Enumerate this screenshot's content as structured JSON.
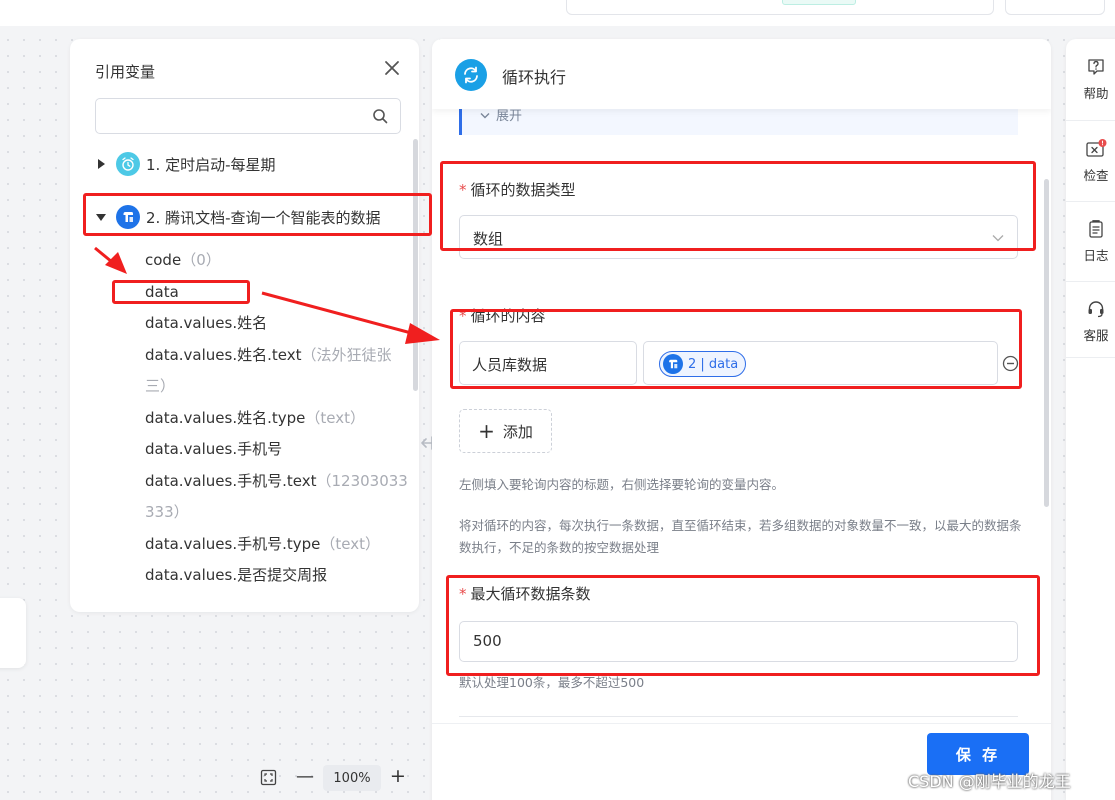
{
  "var_panel": {
    "title": "引用变量",
    "search_placeholder": "",
    "nodes": [
      {
        "label": "1. 定时启动-每星期",
        "color": "#4dc9e6"
      },
      {
        "label": "2. 腾讯文档-查询一个智能表的数据",
        "color": "#1e73e8"
      }
    ],
    "leaves": [
      {
        "name": "code",
        "hint": "（0）"
      },
      {
        "name": "data",
        "hint": ""
      },
      {
        "name": "data.values.姓名",
        "hint": ""
      },
      {
        "name": "data.values.姓名.text",
        "hint": "（法外狂徒张",
        "hint2": "三）"
      },
      {
        "name": "data.values.姓名.type",
        "hint": "（text）"
      },
      {
        "name": "data.values.手机号",
        "hint": ""
      },
      {
        "name": "data.values.手机号.text",
        "hint": "（12303033",
        "hint2": "333）"
      },
      {
        "name": "data.values.手机号.type",
        "hint": "（text）"
      },
      {
        "name": "data.values.是否提交周报",
        "hint": ""
      }
    ]
  },
  "main_panel": {
    "title": "循环执行",
    "expand_label": "展开",
    "data_type": {
      "label": "循环的数据类型",
      "value": "数组"
    },
    "content": {
      "label": "循环的内容",
      "title_value": "人员库数据",
      "tag_value": "2 | data",
      "add_label": "添加"
    },
    "help1": "左侧填入要轮询内容的标题，右侧选择要轮询的变量内容。",
    "help2": "将对循环的内容，每次执行一条数据，直至循环结束，若多组数据的对象数量不一致，以最大的数据条数执行，不足的条数的按空数据处理",
    "max_count": {
      "label": "最大循环数据条数",
      "value": "500",
      "help": "默认处理100条，最多不超过500"
    },
    "save_label": "保 存"
  },
  "right_bar": [
    {
      "label": "帮助"
    },
    {
      "label": "检查"
    },
    {
      "label": "日志"
    },
    {
      "label": "客服"
    }
  ],
  "zoom": {
    "level": "100%"
  },
  "watermark": "CSDN @刚毕业的龙王",
  "colors": {
    "accent": "#1a6ff5",
    "annotation": "#f01f1f",
    "required": "#e84d4d"
  }
}
